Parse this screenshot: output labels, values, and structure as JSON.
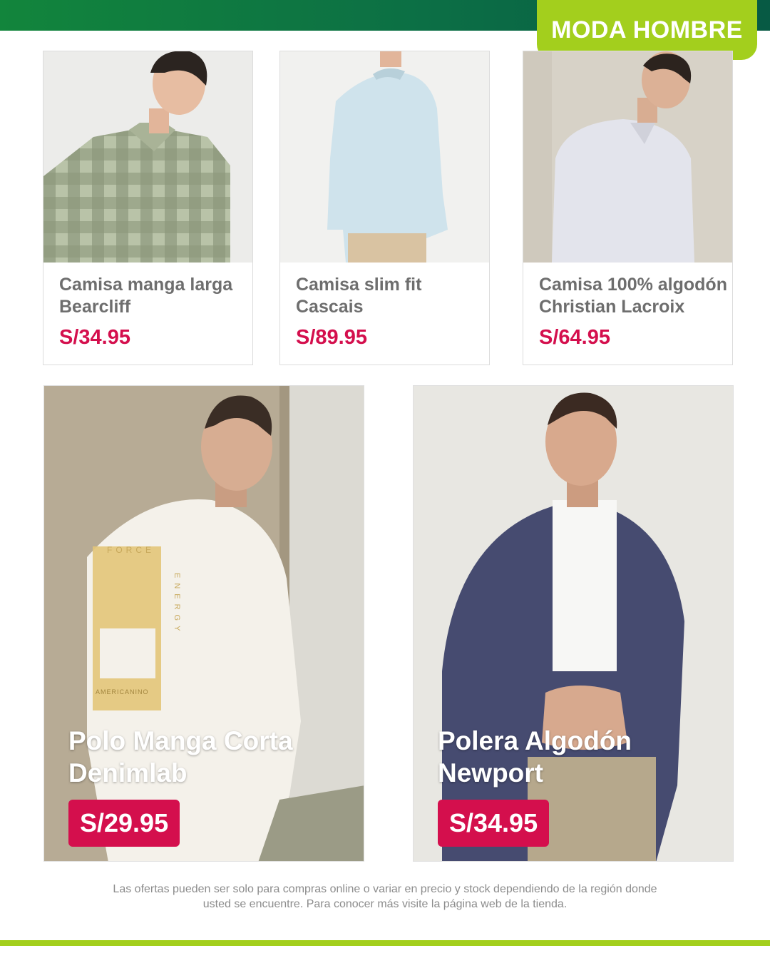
{
  "header": {
    "section_label": "MODA HOMBRE",
    "bar_color": "#0c6f45",
    "badge_color": "#a3cf1d"
  },
  "products_small": [
    {
      "name": "Camisa manga larga Bearcliff",
      "price": "S/34.95"
    },
    {
      "name": "Camisa slim fit Cascais",
      "price": "S/89.95"
    },
    {
      "name": "Camisa 100% algodón Christian Lacroix",
      "price": "S/64.95"
    }
  ],
  "products_large": [
    {
      "name": "Polo Manga Corta Denimlab",
      "price": "S/29.95",
      "print_top": "FORCE",
      "print_side": "ENERGY",
      "print_bottom": "AMERICANINO"
    },
    {
      "name": "Polera Algodón Newport",
      "price": "S/34.95"
    }
  ],
  "footer": {
    "disclaimer": "Las ofertas pueden ser solo para compras online o variar en precio y stock dependiendo de la región donde usted se encuentre. Para conocer más visite la página web de la tienda."
  },
  "colors": {
    "price": "#d40f4d",
    "name_text": "#6e6e6e",
    "accent_green": "#a3cf1d"
  }
}
